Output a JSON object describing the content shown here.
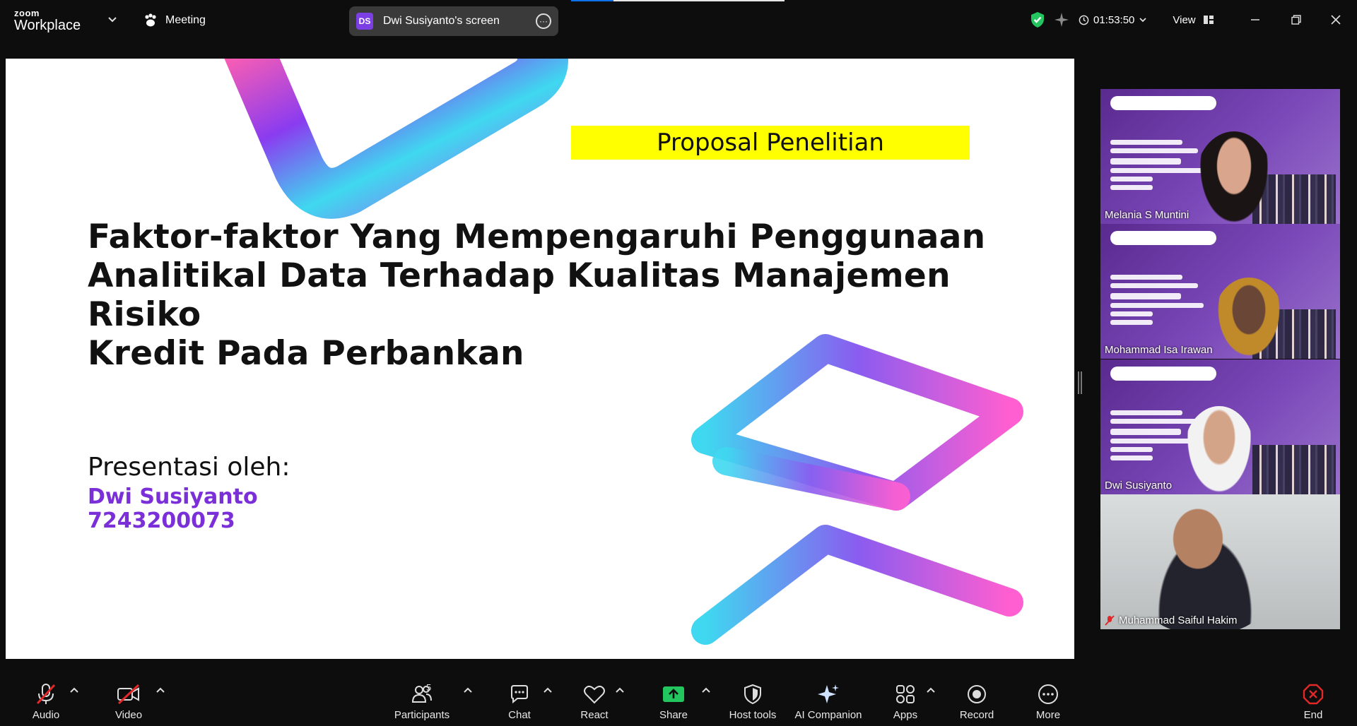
{
  "app": {
    "logo_top": "zoom",
    "logo_bottom": "Workplace",
    "meeting_label": "Meeting",
    "share_initials": "DS",
    "share_label": "Dwi Susiyanto's screen",
    "timer": "01:53:50",
    "view_label": "View",
    "colors": {
      "accent": "#0e72ed",
      "active_speaker": "#23d18b",
      "share_green": "#22c55e",
      "end_red": "#e02828"
    }
  },
  "slide": {
    "tag": "Proposal Penelitian",
    "title_lines": [
      "Faktor-faktor Yang Mempengaruhi Penggunaan",
      "Analitikal Data Terhadap Kualitas Manajemen Risiko",
      "Kredit Pada Perbankan"
    ],
    "presenter_label": "Presentasi oleh:",
    "presenter_name": "Dwi Susiyanto",
    "presenter_id": "7243200073"
  },
  "participants": [
    {
      "name": "Melania S Muntini",
      "muted": false,
      "active": false
    },
    {
      "name": "Mohammad Isa Irawan",
      "muted": false,
      "active": false
    },
    {
      "name": "Dwi Susiyanto",
      "muted": false,
      "active": true
    },
    {
      "name": "Muhammad Saiful Hakim",
      "muted": true,
      "active": false
    }
  ],
  "toolbar": {
    "audio": "Audio",
    "video": "Video",
    "participants": "Participants",
    "participants_count": "5",
    "chat": "Chat",
    "react": "React",
    "share": "Share",
    "host_tools": "Host tools",
    "ai_companion": "AI Companion",
    "apps": "Apps",
    "record": "Record",
    "more": "More",
    "end": "End"
  }
}
